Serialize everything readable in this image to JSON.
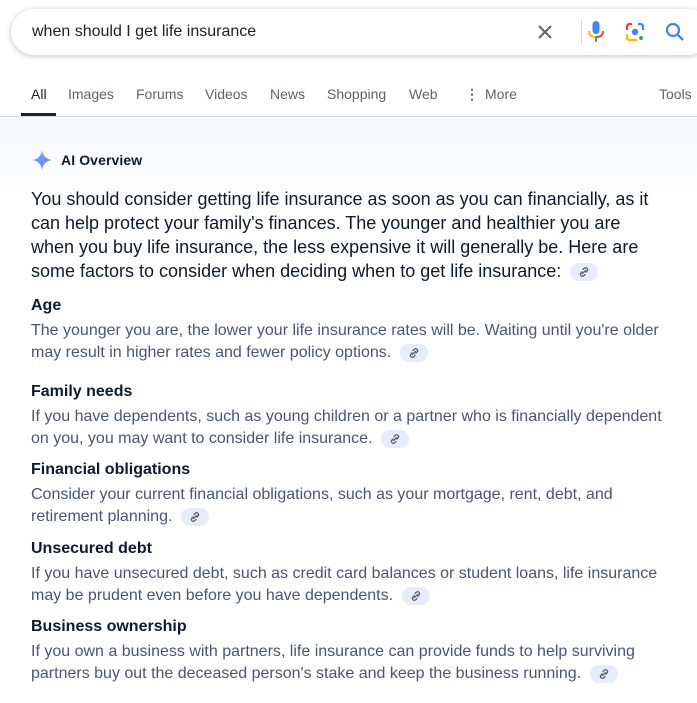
{
  "search": {
    "query": "when should I get life insurance",
    "icons": [
      "close-icon",
      "microphone-icon",
      "google-lens-icon",
      "search-icon"
    ]
  },
  "tabs": [
    {
      "label": "All",
      "active": true
    },
    {
      "label": "Images"
    },
    {
      "label": "Forums"
    },
    {
      "label": "Videos"
    },
    {
      "label": "News"
    },
    {
      "label": "Shopping"
    },
    {
      "label": "Web"
    },
    {
      "label": "More",
      "icon": "more-vert-icon"
    }
  ],
  "tools_label": "Tools",
  "ai_overview": {
    "title": "AI Overview",
    "icon": "sparkle-icon",
    "intro": "You should consider getting life insurance as soon as you can financially, as it can help protect your family's finances. The younger and healthier you are when you buy life insurance, the less expensive it will generally be. Here are some factors to consider when deciding when to get life insurance:",
    "sections": [
      {
        "title": "Age",
        "body": "The younger you are, the lower your life insurance rates will be. Waiting until you're older may result in higher rates and fewer policy options."
      },
      {
        "title": "Family needs",
        "body": "If you have dependents, such as young children or a partner who is financially dependent on you, you may want to consider life insurance."
      },
      {
        "title": "Financial obligations",
        "body": "Consider your current financial obligations, such as your mortgage, rent, debt, and retirement planning."
      },
      {
        "title": "Unsecured debt",
        "body": "If you have unsecured debt, such as credit card balances or student loans, life insurance may be prudent even before you have dependents."
      },
      {
        "title": "Business ownership",
        "body": "If you own a business with partners, life insurance can provide funds to help surviving partners buy out the deceased person's stake and keep the business running."
      }
    ],
    "link_icon": "link-icon"
  },
  "colors": {
    "blue": "#4285f4",
    "red": "#ea4335",
    "yellow": "#fbbc04",
    "green": "#34a853",
    "heading_text": "#0e1b2c",
    "body_text": "#4a5571",
    "chip_bg": "#e6ecfb"
  }
}
